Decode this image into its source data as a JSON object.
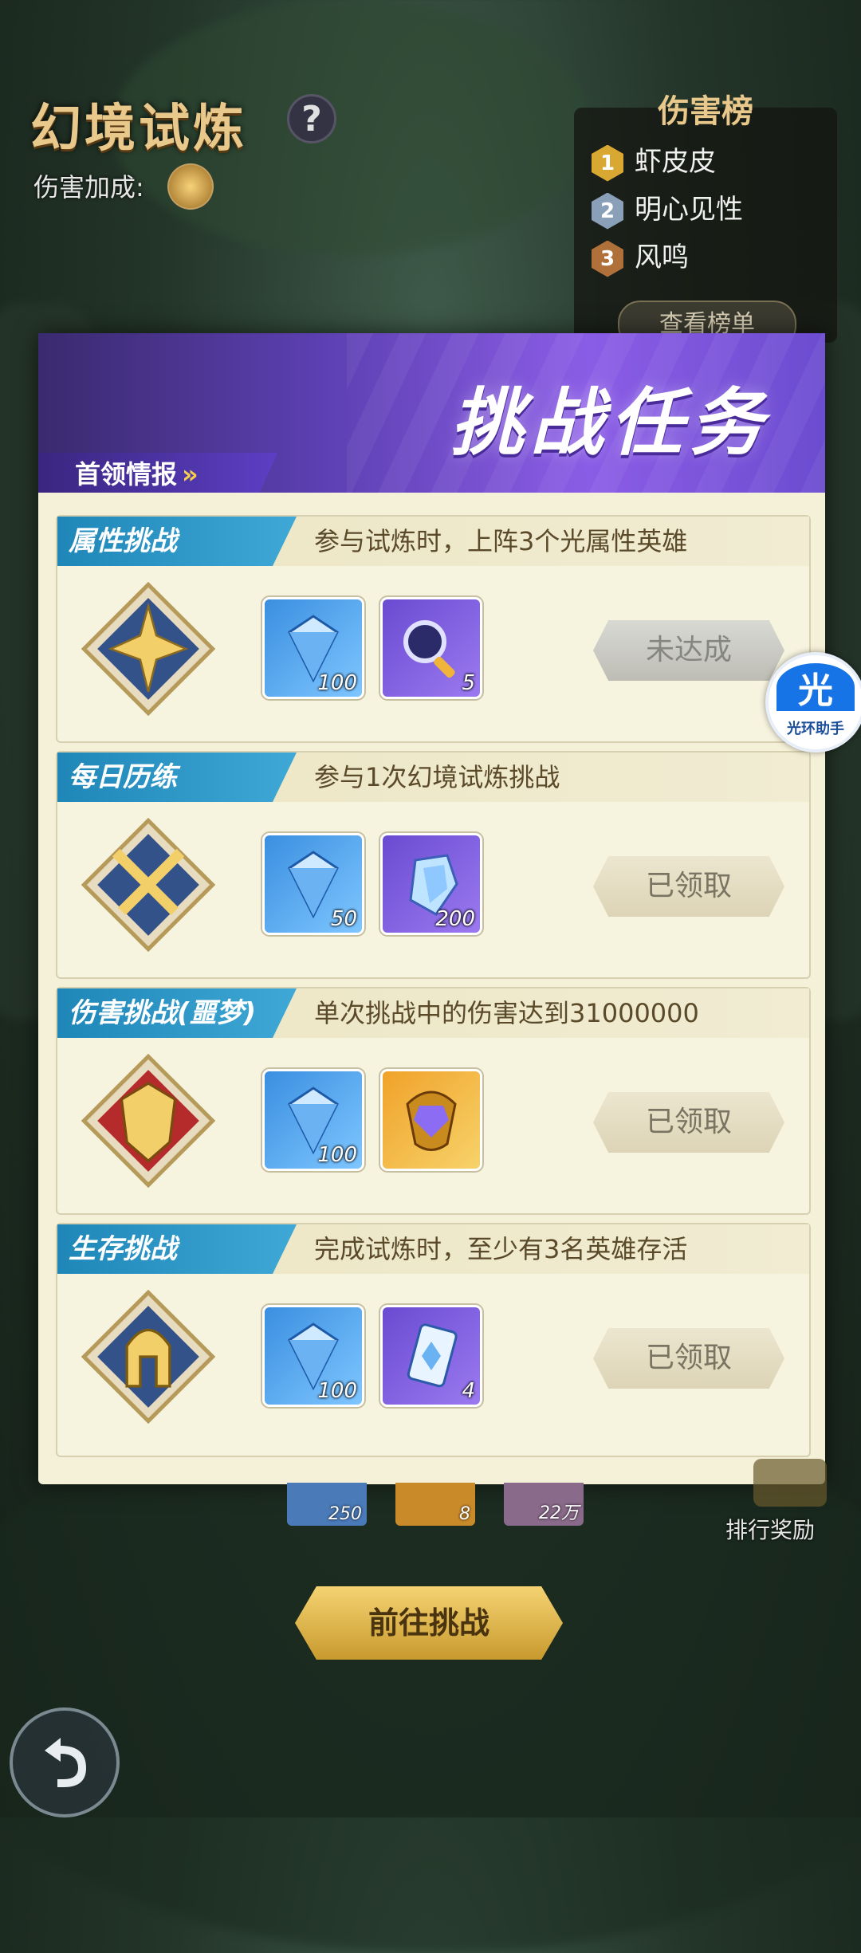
{
  "header": {
    "title": "幻境试炼",
    "help": "?",
    "bonus_label": "伤害加成:"
  },
  "ranking": {
    "title": "伤害榜",
    "entries": [
      {
        "rank": "1",
        "name": "虾皮皮"
      },
      {
        "rank": "2",
        "name": "明心见性"
      },
      {
        "rank": "3",
        "name": "风鸣"
      }
    ],
    "view_button": "查看榜单"
  },
  "modal": {
    "title": "挑战任务",
    "boss_tag": "首领情报",
    "boss_chevron": "»"
  },
  "tasks": [
    {
      "tag": "属性挑战",
      "desc": "参与试炼时，上阵3个光属性英雄",
      "badge_icon": "light-element-badge-icon",
      "rewards": [
        {
          "icon": "diamond-icon",
          "qty": "100"
        },
        {
          "icon": "magnifier-icon",
          "qty": "5"
        }
      ],
      "status": "未达成"
    },
    {
      "tag": "每日历练",
      "desc": "参与1次幻境试炼挑战",
      "badge_icon": "crossed-swords-badge-icon",
      "rewards": [
        {
          "icon": "diamond-icon",
          "qty": "50"
        },
        {
          "icon": "crystal-icon",
          "qty": "200"
        }
      ],
      "status": "已领取"
    },
    {
      "tag": "伤害挑战(噩梦)",
      "desc": "单次挑战中的伤害达到31000000",
      "badge_icon": "demon-badge-icon",
      "rewards": [
        {
          "icon": "diamond-icon",
          "qty": "100"
        },
        {
          "icon": "gem-frame-icon",
          "qty": ""
        }
      ],
      "status": "已领取"
    },
    {
      "tag": "生存挑战",
      "desc": "完成试炼时，至少有3名英雄存活",
      "badge_icon": "helmet-badge-icon",
      "rewards": [
        {
          "icon": "diamond-icon",
          "qty": "100"
        },
        {
          "icon": "card-icon",
          "qty": "4"
        }
      ],
      "status": "已领取"
    }
  ],
  "helper": {
    "glyph": "光",
    "label": "光环助手"
  },
  "under": {
    "items": [
      {
        "icon": "diamond-icon",
        "qty": "250"
      },
      {
        "icon": "scroll-icon",
        "qty": "8"
      },
      {
        "icon": "coin-icon",
        "qty": "22万"
      }
    ],
    "reward_label": "排行奖励",
    "goto_button": "前往挑战"
  }
}
